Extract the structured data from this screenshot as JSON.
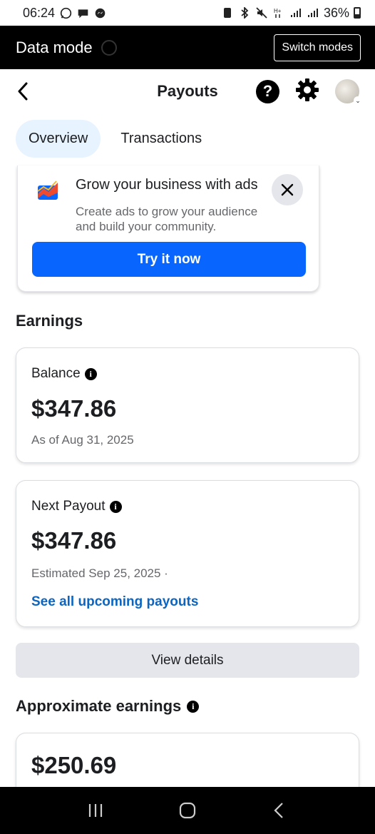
{
  "status_bar": {
    "time": "06:24",
    "battery": "36%"
  },
  "mode_bar": {
    "title": "Data mode",
    "switch_label": "Switch modes"
  },
  "header": {
    "title": "Payouts"
  },
  "tabs": [
    {
      "label": "Overview",
      "active": true
    },
    {
      "label": "Transactions",
      "active": false
    }
  ],
  "promo": {
    "title": "Grow your business with ads",
    "description": "Create ads to grow your audience and build your community.",
    "button_label": "Try it now"
  },
  "earnings": {
    "section_title": "Earnings",
    "balance": {
      "label": "Balance",
      "amount": "$347.86",
      "sub": "As of Aug 31, 2025"
    },
    "next_payout": {
      "label": "Next Payout",
      "amount": "$347.86",
      "sub": "Estimated Sep 25, 2025 ·",
      "link": "See all upcoming payouts"
    },
    "view_details_label": "View details"
  },
  "approximate": {
    "section_title": "Approximate earnings",
    "amount": "$250.69"
  },
  "colors": {
    "accent": "#0866ff",
    "link": "#0a66c2",
    "tab_active_bg": "#e7f3ff"
  }
}
